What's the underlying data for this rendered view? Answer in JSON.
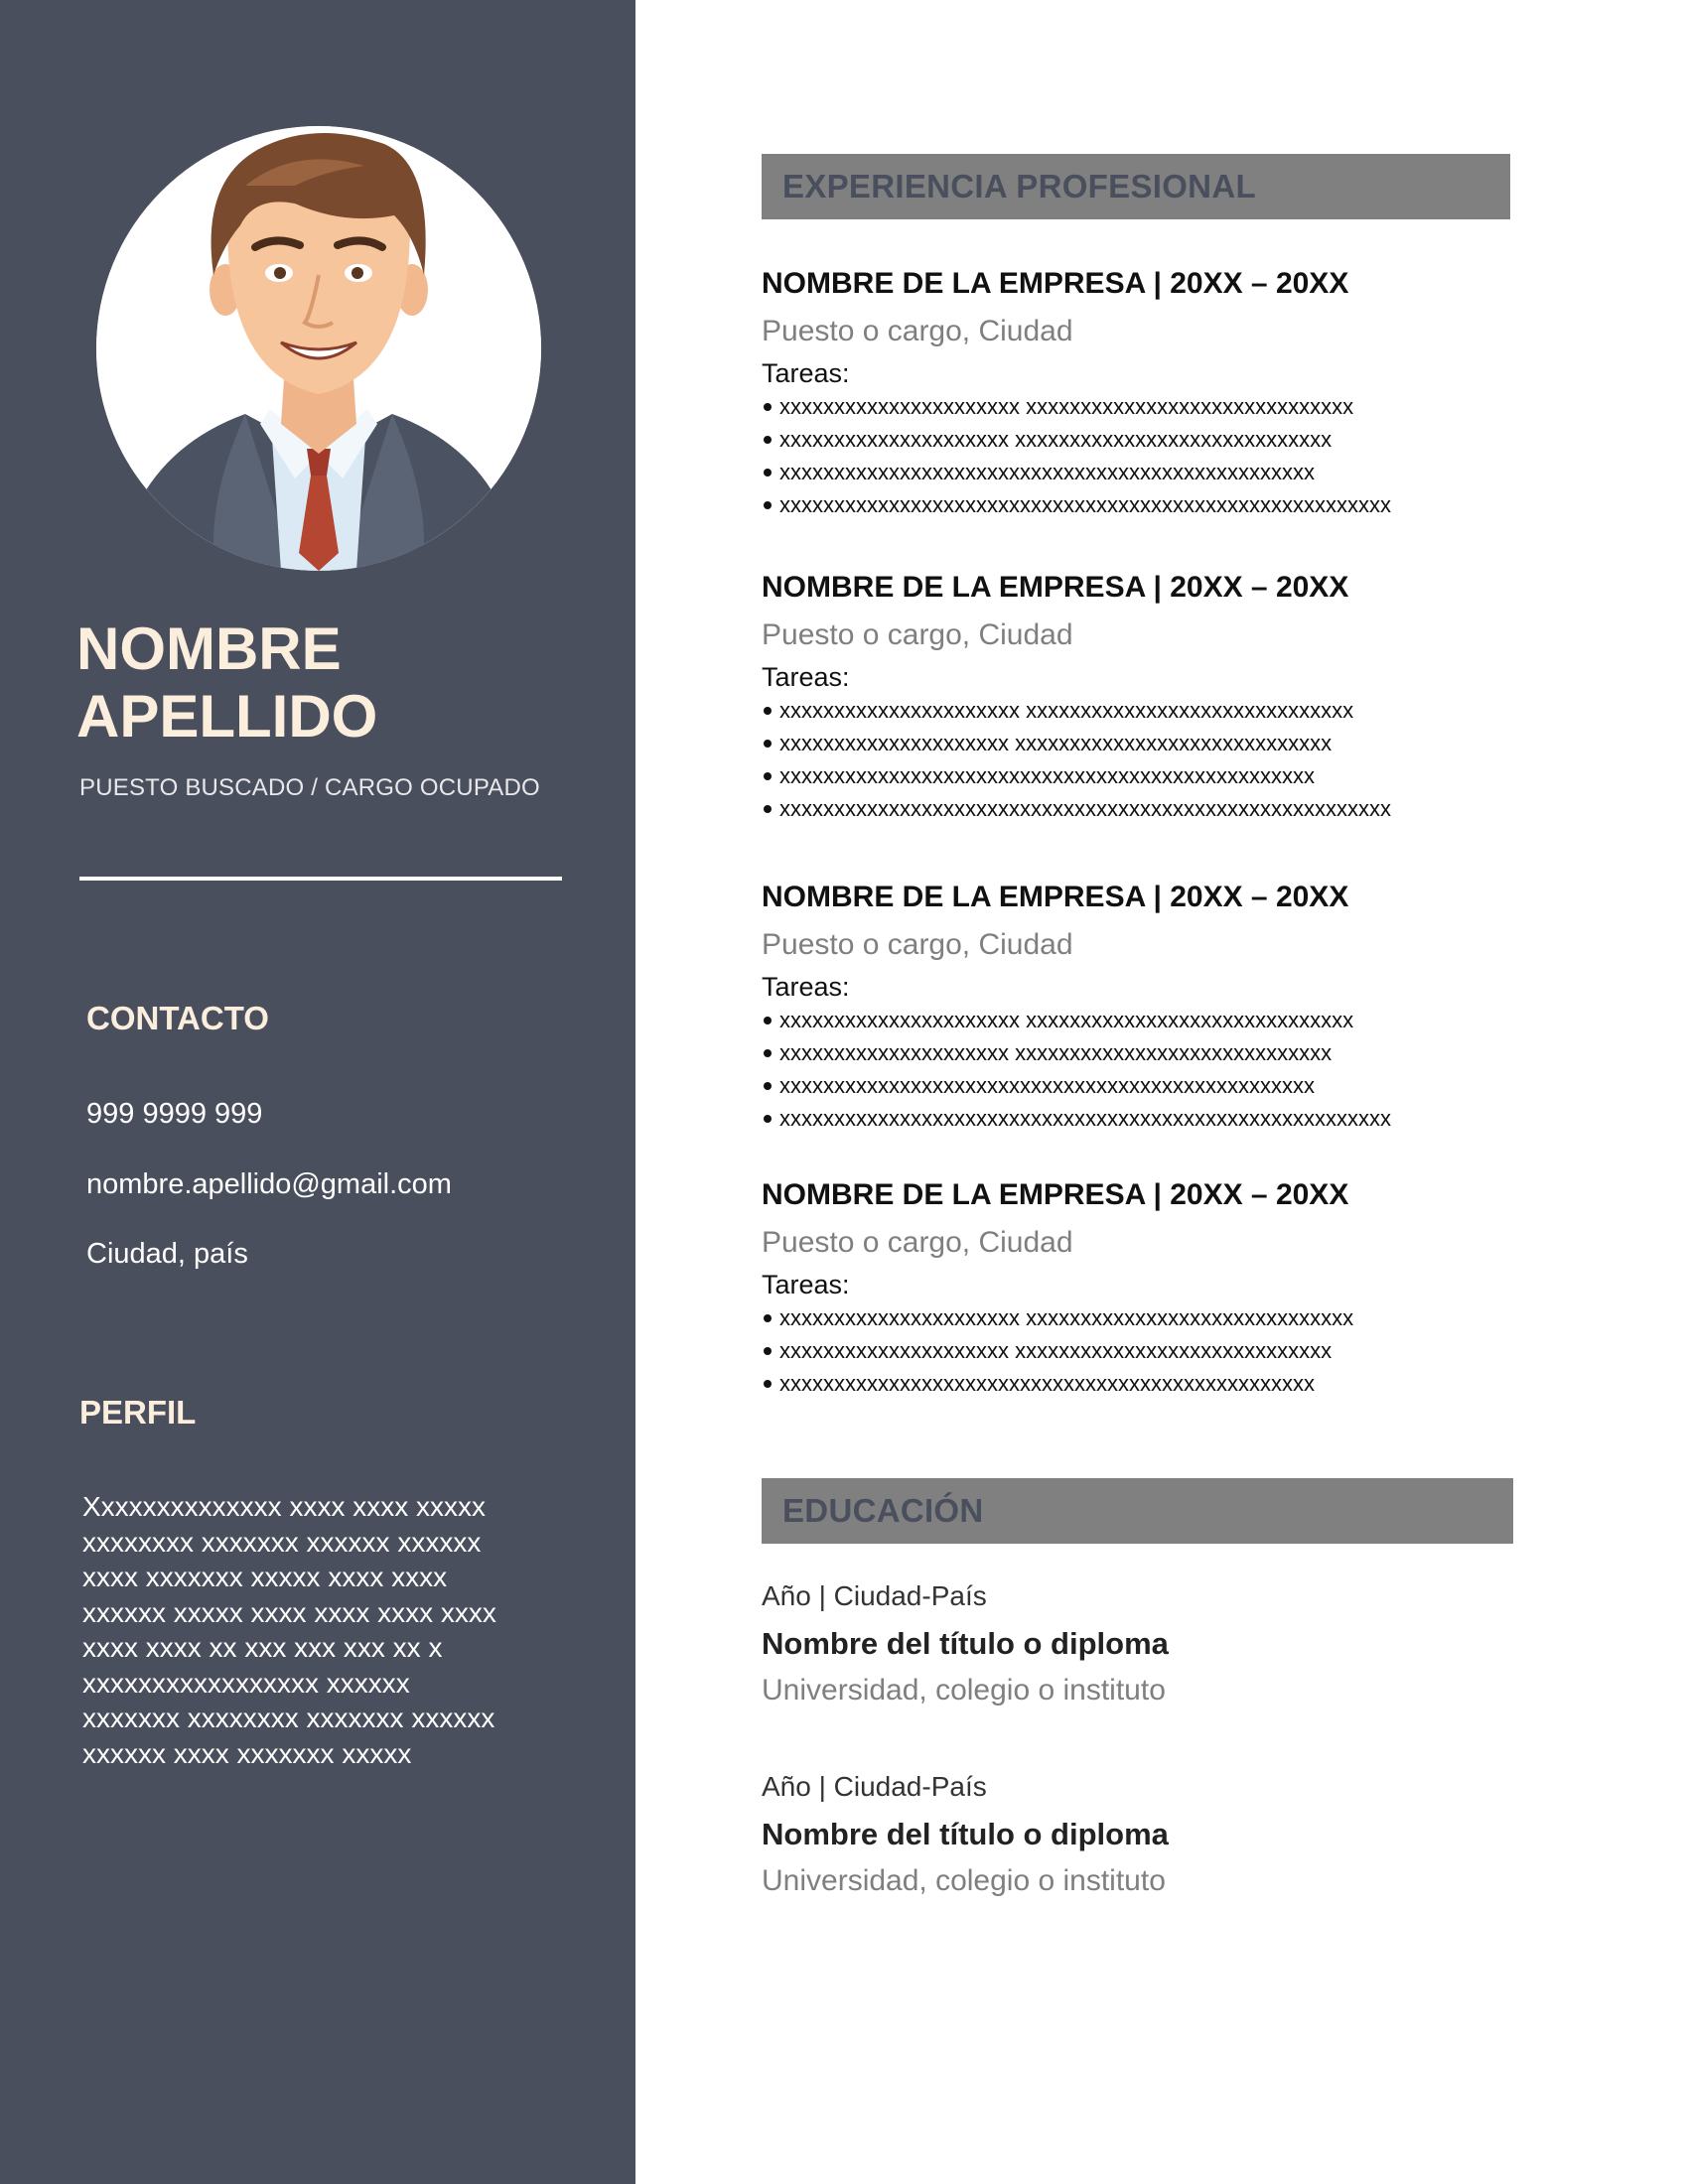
{
  "sidebar": {
    "photo_icon": "man-in-suit-avatar",
    "first_name": "NOMBRE",
    "last_name": "APELLIDO",
    "subtitle": "PUESTO BUSCADO / CARGO OCUPADO",
    "contact_heading": "CONTACTO",
    "phone": "999 9999 999",
    "email": "nombre.apellido@gmail.com",
    "location": "Ciudad, país",
    "profile_heading": "PERFIL",
    "profile_lines": [
      "Xxxxxxxxxxxxxx xxxx xxxx xxxxx",
      "xxxxxxxx xxxxxxx xxxxxx xxxxxx",
      "xxxx xxxxxxx xxxxx xxxx xxxx",
      "xxxxxx xxxxx xxxx xxxx xxxx xxxx",
      "xxxx xxxx xx xxx xxx xxx xx x",
      "xxxxxxxxxxxxxxxxx xxxxxx",
      "xxxxxxx xxxxxxxx xxxxxxx xxxxxx",
      "xxxxxx xxxx xxxxxxx xxxxx"
    ]
  },
  "experience": {
    "heading": "EXPERIENCIA PROFESIONAL",
    "jobs": [
      {
        "title": "NOMBRE DE LA EMPRESA | 20XX – 20XX",
        "role": "Puesto o cargo, Ciudad",
        "tasks_label": "Tareas:",
        "tasks": [
          "xxxxxxxxxxxxxxxxxxxxxx xxxxxxxxxxxxxxxxxxxxxxxxxxxxxx",
          "xxxxxxxxxxxxxxxxxxxxx xxxxxxxxxxxxxxxxxxxxxxxxxxxxx",
          "xxxxxxxxxxxxxxxxxxxxxxxxxxxxxxxxxxxxxxxxxxxxxxxxx",
          "xxxxxxxxxxxxxxxxxxxxxxxxxxxxxxxxxxxxxxxxxxxxxxxxxxxxxxxx"
        ]
      },
      {
        "title": "NOMBRE DE LA EMPRESA | 20XX – 20XX",
        "role": "Puesto o cargo, Ciudad",
        "tasks_label": "Tareas:",
        "tasks": [
          "xxxxxxxxxxxxxxxxxxxxxx xxxxxxxxxxxxxxxxxxxxxxxxxxxxxx",
          "xxxxxxxxxxxxxxxxxxxxx xxxxxxxxxxxxxxxxxxxxxxxxxxxxx",
          "xxxxxxxxxxxxxxxxxxxxxxxxxxxxxxxxxxxxxxxxxxxxxxxxx",
          "xxxxxxxxxxxxxxxxxxxxxxxxxxxxxxxxxxxxxxxxxxxxxxxxxxxxxxxx"
        ]
      },
      {
        "title": "NOMBRE DE LA EMPRESA | 20XX – 20XX",
        "role": "Puesto o cargo, Ciudad",
        "tasks_label": "Tareas:",
        "tasks": [
          "xxxxxxxxxxxxxxxxxxxxxx xxxxxxxxxxxxxxxxxxxxxxxxxxxxxx",
          "xxxxxxxxxxxxxxxxxxxxx xxxxxxxxxxxxxxxxxxxxxxxxxxxxx",
          "xxxxxxxxxxxxxxxxxxxxxxxxxxxxxxxxxxxxxxxxxxxxxxxxx",
          "xxxxxxxxxxxxxxxxxxxxxxxxxxxxxxxxxxxxxxxxxxxxxxxxxxxxxxxx"
        ]
      },
      {
        "title": "NOMBRE DE LA EMPRESA | 20XX – 20XX",
        "role": "Puesto o cargo, Ciudad",
        "tasks_label": "Tareas:",
        "tasks": [
          "xxxxxxxxxxxxxxxxxxxxxx xxxxxxxxxxxxxxxxxxxxxxxxxxxxxx",
          "xxxxxxxxxxxxxxxxxxxxx xxxxxxxxxxxxxxxxxxxxxxxxxxxxx",
          "xxxxxxxxxxxxxxxxxxxxxxxxxxxxxxxxxxxxxxxxxxxxxxxxx"
        ]
      }
    ]
  },
  "education": {
    "heading": "EDUCACIÓN",
    "entries": [
      {
        "meta": "Año | Ciudad-País",
        "degree": "Nombre del título o diploma",
        "institution": "Universidad, colegio o instituto"
      },
      {
        "meta": "Año | Ciudad-País",
        "degree": "Nombre del título o diploma",
        "institution": "Universidad, colegio o instituto"
      }
    ]
  },
  "colors": {
    "sidebar_bg": "#4a4f5e",
    "name_color": "#fbeedd",
    "section_bar": "#808080",
    "muted_text": "#7f7f7f"
  }
}
